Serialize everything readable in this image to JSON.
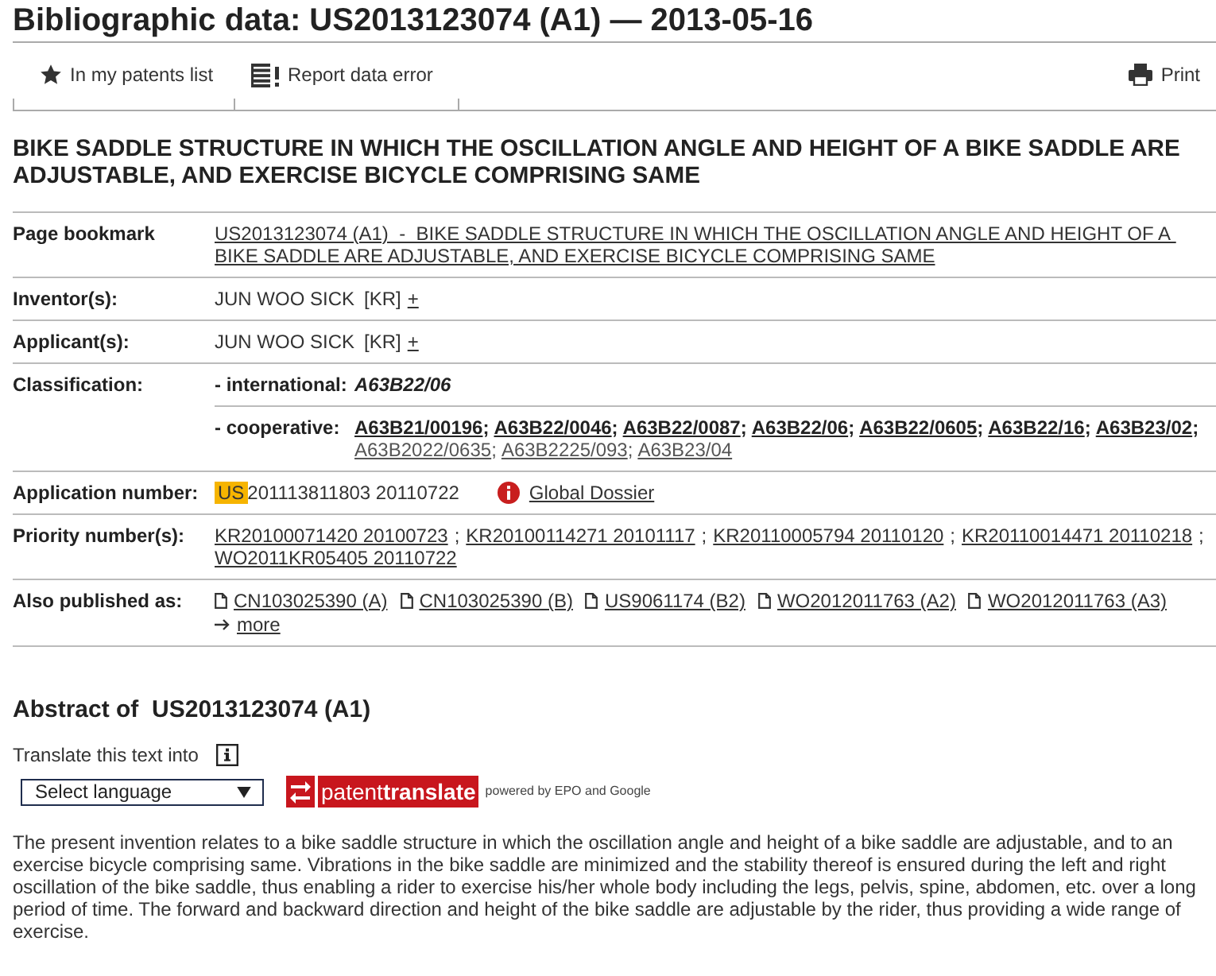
{
  "header": {
    "title": "Bibliographic data: US2013123074 (A1) — 2013-05-16"
  },
  "toolbar": [
    {
      "kind": "star",
      "label": "In my patents list"
    },
    {
      "kind": "report",
      "label": "Report data error"
    },
    {
      "kind": "print",
      "label": "Print"
    }
  ],
  "document_title": "BIKE SADDLE STRUCTURE IN WHICH THE OSCILLATION ANGLE AND HEIGHT OF A BIKE SADDLE ARE ADJUSTABLE, AND EXERCISE BICYCLE COMPRISING SAME",
  "rows": [
    {
      "kind": "bookmark",
      "label": "Page bookmark",
      "link": "US2013123074 (A1)  -  BIKE SADDLE STRUCTURE IN WHICH THE OSCILLATION ANGLE AND HEIGHT OF A BIKE SADDLE ARE ADJUSTABLE, AND EXERCISE BICYCLE COMPRISING SAME"
    },
    {
      "kind": "people",
      "label": "Inventor(s):",
      "items": [
        {
          "name": "JUN WOO SICK",
          "country": "[KR]",
          "more": "+"
        }
      ]
    },
    {
      "kind": "people",
      "label": "Applicant(s):",
      "items": [
        {
          "name": "JUN WOO SICK",
          "country": "[KR]",
          "more": "+"
        }
      ]
    },
    {
      "kind": "classification",
      "label": "Classification:",
      "groups": [
        {
          "label": "- international:",
          "codes": [
            {
              "code": "A63B22/06",
              "kind": "international"
            }
          ]
        },
        {
          "label": "- cooperative:",
          "separator": ";",
          "codes": [
            {
              "code": "A63B21/00196",
              "kind": "inventive"
            },
            {
              "code": "A63B22/0046",
              "kind": "inventive"
            },
            {
              "code": "A63B22/0087",
              "kind": "inventive"
            },
            {
              "code": "A63B22/06",
              "kind": "inventive"
            },
            {
              "code": "A63B22/0605",
              "kind": "inventive"
            },
            {
              "code": "A63B22/16",
              "kind": "inventive"
            },
            {
              "code": "A63B23/02",
              "kind": "inventive"
            },
            {
              "code": "A63B2022/0635",
              "kind": "additional"
            },
            {
              "code": "A63B2225/093",
              "kind": "additional"
            },
            {
              "code": "A63B23/04",
              "kind": "additional"
            }
          ]
        }
      ]
    },
    {
      "kind": "application",
      "label": "Application number:",
      "country": "US",
      "number": "201113811803 20110722",
      "link": "Global Dossier"
    },
    {
      "kind": "numbers",
      "label": "Priority number(s):",
      "separator": ";",
      "items": [
        "KR20100071420 20100723",
        "KR20100114271 20101117",
        "KR20110005794 20110120",
        "KR20110014471 20110218",
        "WO2011KR05405 20110722"
      ]
    },
    {
      "kind": "publications",
      "label": "Also published as:",
      "items": [
        "CN103025390 (A)",
        "CN103025390 (B)",
        "US9061174 (B2)",
        "WO2012011763 (A2)",
        "WO2012011763 (A3)"
      ],
      "more": "more"
    }
  ],
  "abstract": {
    "title": "Abstract of  US2013123074 (A1)",
    "translate_label": "Translate this text into",
    "language_select": "Select language",
    "translate_logo": "patent**translate**",
    "powered_by": "powered by EPO and Google",
    "text": "The present invention relates to a bike saddle structure in which the oscillation angle and height of a bike saddle are adjustable, and to an exercise bicycle comprising same. Vibrations in the bike saddle are minimized and the stability thereof is ensured during the left and right oscillation of the bike saddle, thus enabling a rider to exercise his/her whole body including the legs, pelvis, spine, abdomen, etc. over a long period of time. The forward and backward direction and height of the bike saddle are adjustable by the rider, thus providing a wide range of exercise."
  }
}
